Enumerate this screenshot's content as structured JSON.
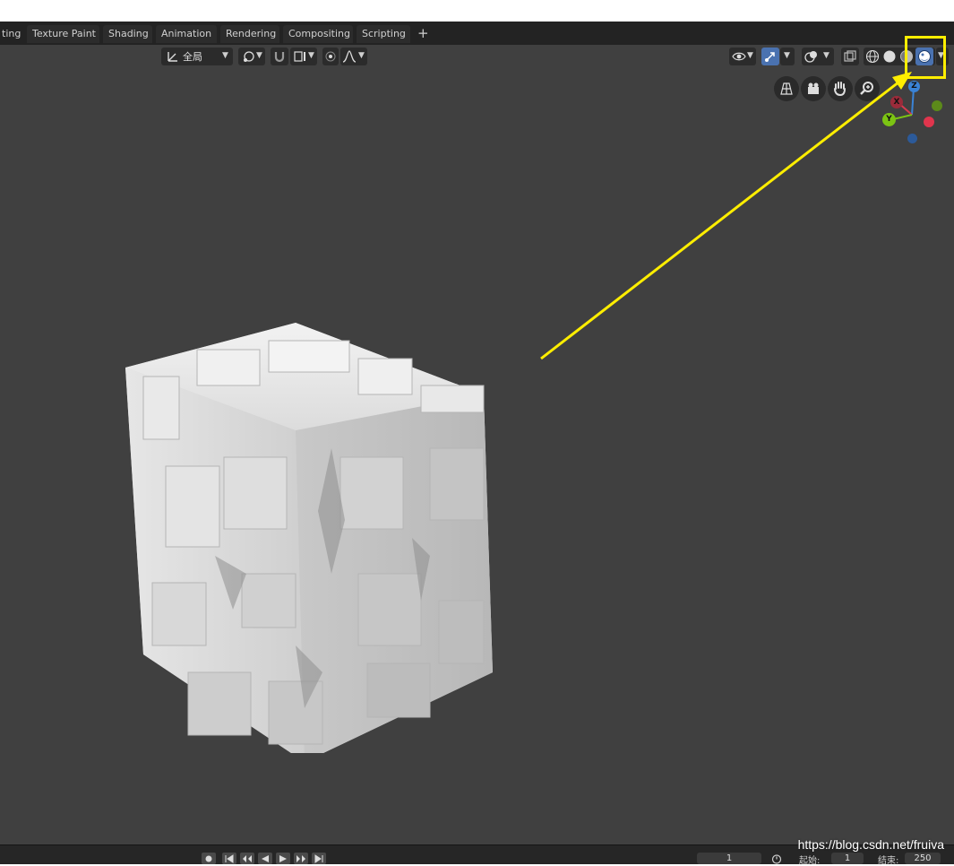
{
  "workspace_tabs": [
    {
      "label": "ting"
    },
    {
      "label": "Texture Paint"
    },
    {
      "label": "Shading"
    },
    {
      "label": "Animation"
    },
    {
      "label": "Rendering"
    },
    {
      "label": "Compositing"
    },
    {
      "label": "Scripting"
    }
  ],
  "add_workspace_label": "+",
  "header": {
    "orientation_label": "全局",
    "shading_modes": [
      "wireframe",
      "solid",
      "material-preview",
      "rendered"
    ],
    "active_shading_mode": "rendered"
  },
  "gizmo": {
    "x_label": "X",
    "y_label": "Y",
    "z_label": "Z"
  },
  "timeline": {
    "current_frame": "1",
    "start_label": "起始:",
    "start_value": "1",
    "end_label": "结束:",
    "end_value": "250"
  },
  "watermark": "https://blog.csdn.net/fruiva",
  "annotation_color": "#ffee00",
  "colors": {
    "viewport": "#404040",
    "active_button": "#4a72b0",
    "x_axis": "#d63a4e",
    "y_axis": "#7cc413",
    "z_axis": "#3a83d6"
  }
}
